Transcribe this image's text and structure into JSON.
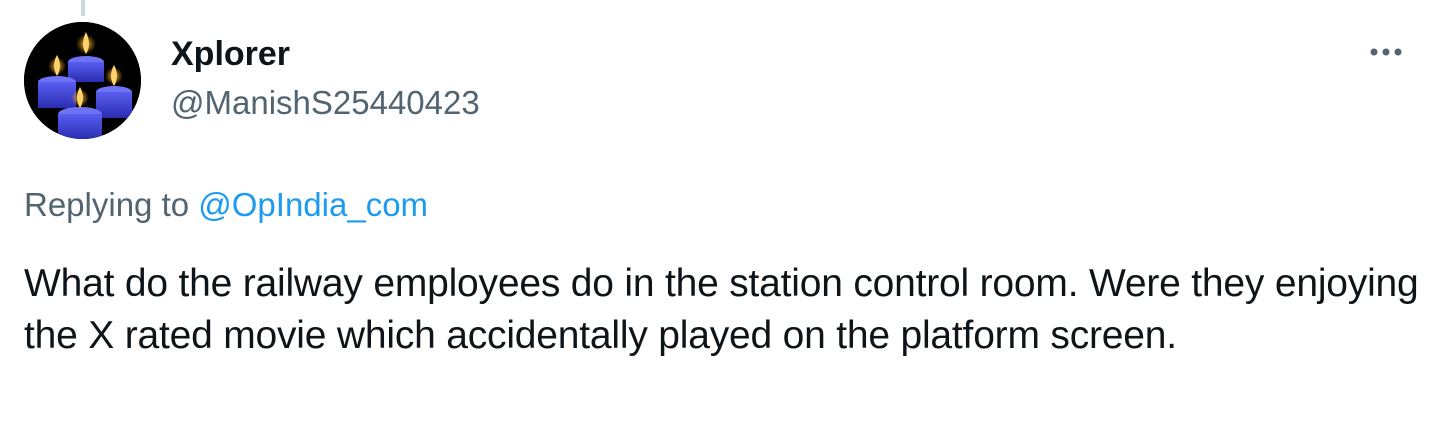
{
  "author": {
    "display_name": "Xplorer",
    "handle": "@ManishS25440423",
    "avatar_icon": "candles-avatar"
  },
  "more_icon": "more-horizontal-icon",
  "reply": {
    "prefix": "Replying to ",
    "mention": "@OpIndia_com"
  },
  "tweet": {
    "text": "What do the railway employees do in the station control room. Were they enjoying the X rated movie which accidentally played on the platform screen."
  },
  "colors": {
    "text_primary": "#0f1419",
    "text_secondary": "#536471",
    "link": "#1d9bf0",
    "avatar_candles": "#3b3fd6"
  }
}
